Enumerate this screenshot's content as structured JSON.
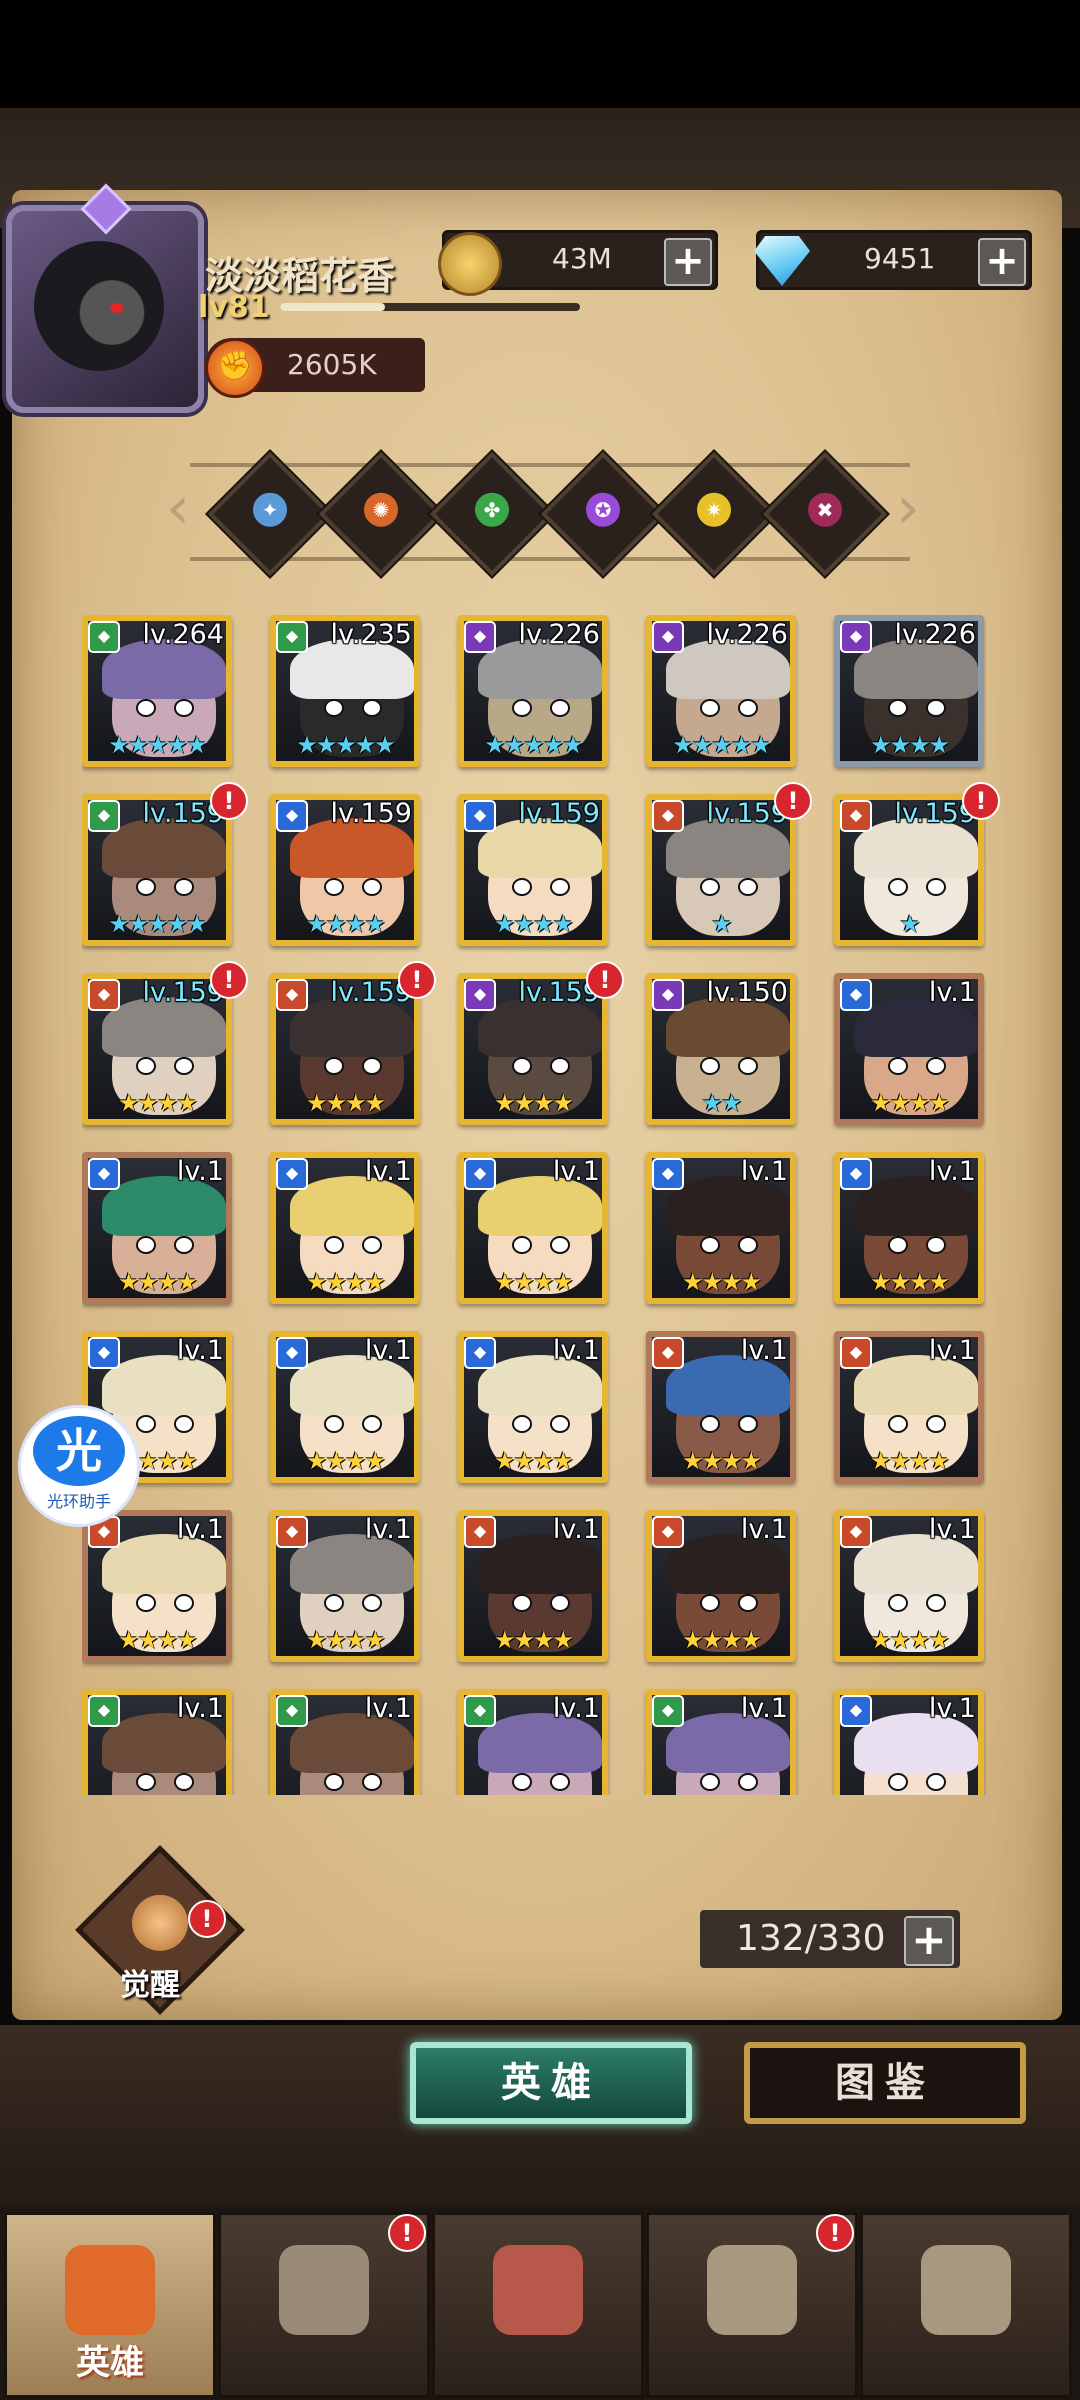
{
  "player": {
    "name": "淡淡稻花香",
    "level": "lv81",
    "xp_fraction": 0.35,
    "power": "2605K"
  },
  "resources": {
    "gold": "43M",
    "diamonds": "9451",
    "plus": "+"
  },
  "filters": [
    {
      "name": "all-element",
      "color": "#5a9ad8",
      "glyph": "✦"
    },
    {
      "name": "fire-element",
      "color": "#d8682a",
      "glyph": "✺"
    },
    {
      "name": "nature-element",
      "color": "#3aa84a",
      "glyph": "✤"
    },
    {
      "name": "arcane-element",
      "color": "#9a4ad8",
      "glyph": "✪"
    },
    {
      "name": "light-element",
      "color": "#e8c128",
      "glyph": "✷"
    },
    {
      "name": "dark-element",
      "color": "#a02a5a",
      "glyph": "✖"
    }
  ],
  "heroes": [
    {
      "lv": "lv.264",
      "stars": "★★★★★",
      "starColor": "#5ad0f0",
      "frame": "#e6b531",
      "elem": "#2e9a4a",
      "lvColor": "#ffffff",
      "alert": false,
      "hair": "#7a6aa8",
      "skin": "#c9a9b8"
    },
    {
      "lv": "lv.235",
      "stars": "★★★★★",
      "starColor": "#5ad0f0",
      "frame": "#e6b531",
      "elem": "#2e9a4a",
      "lvColor": "#ffffff",
      "alert": false,
      "hair": "#e8e8e8",
      "skin": "#2a2a2a"
    },
    {
      "lv": "lv.226",
      "stars": "★★★★★",
      "starColor": "#5ad0f0",
      "frame": "#e6b531",
      "elem": "#7a3ab8",
      "lvColor": "#ffffff",
      "alert": false,
      "hair": "#9a9a9a",
      "skin": "#b8a888"
    },
    {
      "lv": "lv.226",
      "stars": "★★★★★",
      "starColor": "#5ad0f0",
      "frame": "#e6b531",
      "elem": "#7a3ab8",
      "lvColor": "#ffffff",
      "alert": false,
      "hair": "#cfc8c0",
      "skin": "#c4a890"
    },
    {
      "lv": "lv.226",
      "stars": "★★★★",
      "starColor": "#5ad0f0",
      "frame": "#8c9aa8",
      "elem": "#7a3ab8",
      "lvColor": "#ffffff",
      "alert": false,
      "hair": "#8a8580",
      "skin": "#3a302c"
    },
    {
      "lv": "lv.159",
      "stars": "★★★★★",
      "starColor": "#5ad0f0",
      "frame": "#e6b531",
      "elem": "#2e9a4a",
      "lvColor": "#7fe8ff",
      "alert": true,
      "hair": "#6a4a38",
      "skin": "#a98a7c"
    },
    {
      "lv": "lv.159",
      "stars": "★★★★",
      "starColor": "#5ad0f0",
      "frame": "#e6b531",
      "elem": "#2a6ad8",
      "lvColor": "#ffffff",
      "alert": false,
      "hair": "#c8582a",
      "skin": "#f0c8a8"
    },
    {
      "lv": "lv.159",
      "stars": "★★★★",
      "starColor": "#5ad0f0",
      "frame": "#e6b531",
      "elem": "#2a6ad8",
      "lvColor": "#7fe8ff",
      "alert": false,
      "hair": "#e8d8a8",
      "skin": "#f5dcc0"
    },
    {
      "lv": "lv.159",
      "stars": "★",
      "starColor": "#5ad0f0",
      "frame": "#e6b531",
      "elem": "#c84a2a",
      "lvColor": "#7fe8ff",
      "alert": true,
      "hair": "#8a8580",
      "skin": "#d8c8b8"
    },
    {
      "lv": "lv.159",
      "stars": "★",
      "starColor": "#5ad0f0",
      "frame": "#e6b531",
      "elem": "#c84a2a",
      "lvColor": "#7fe8ff",
      "alert": true,
      "hair": "#e8e0d0",
      "skin": "#f0e8dc"
    },
    {
      "lv": "lv.159",
      "stars": "★★★★",
      "starColor": "#ffd23a",
      "frame": "#e6b531",
      "elem": "#c84a2a",
      "lvColor": "#7fe8ff",
      "alert": true,
      "hair": "#8a8580",
      "skin": "#e0d0c0"
    },
    {
      "lv": "lv.159",
      "stars": "★★★★",
      "starColor": "#ffd23a",
      "frame": "#e6b531",
      "elem": "#c84a2a",
      "lvColor": "#7fe8ff",
      "alert": true,
      "hair": "#3a3030",
      "skin": "#5a3a30"
    },
    {
      "lv": "lv.159",
      "stars": "★★★★",
      "starColor": "#ffd23a",
      "frame": "#e6b531",
      "elem": "#7a3ab8",
      "lvColor": "#7fe8ff",
      "alert": true,
      "hair": "#3a3030",
      "skin": "#5a4a40"
    },
    {
      "lv": "lv.150",
      "stars": "★★",
      "starColor": "#5ad0f0",
      "frame": "#e6b531",
      "elem": "#7a3ab8",
      "lvColor": "#ffffff",
      "alert": false,
      "hair": "#6a4a30",
      "skin": "#c8b090"
    },
    {
      "lv": "lv.1",
      "stars": "★★★★",
      "starColor": "#ffd23a",
      "frame": "#b07a5a",
      "elem": "#2a6ad8",
      "lvColor": "#ffffff",
      "alert": false,
      "hair": "#2a2a3a",
      "skin": "#d8a888"
    },
    {
      "lv": "lv.1",
      "stars": "★★★★",
      "starColor": "#ffd23a",
      "frame": "#b07a5a",
      "elem": "#2a6ad8",
      "lvColor": "#ffffff",
      "alert": false,
      "hair": "#2a8a6a",
      "skin": "#d8b098"
    },
    {
      "lv": "lv.1",
      "stars": "★★★★",
      "starColor": "#ffd23a",
      "frame": "#e6b531",
      "elem": "#2a6ad8",
      "lvColor": "#ffffff",
      "alert": false,
      "hair": "#e8d070",
      "skin": "#f5dcc0"
    },
    {
      "lv": "lv.1",
      "stars": "★★★★",
      "starColor": "#ffd23a",
      "frame": "#e6b531",
      "elem": "#2a6ad8",
      "lvColor": "#ffffff",
      "alert": false,
      "hair": "#e8d070",
      "skin": "#f5dcc0"
    },
    {
      "lv": "lv.1",
      "stars": "★★★★",
      "starColor": "#ffd23a",
      "frame": "#e6b531",
      "elem": "#2a6ad8",
      "lvColor": "#ffffff",
      "alert": false,
      "hair": "#2a2020",
      "skin": "#7a4a38"
    },
    {
      "lv": "lv.1",
      "stars": "★★★★",
      "starColor": "#ffd23a",
      "frame": "#e6b531",
      "elem": "#2a6ad8",
      "lvColor": "#ffffff",
      "alert": false,
      "hair": "#2a2020",
      "skin": "#7a4a38"
    },
    {
      "lv": "lv.1",
      "stars": "★★★★",
      "starColor": "#ffd23a",
      "frame": "#e6b531",
      "elem": "#2a6ad8",
      "lvColor": "#ffffff",
      "alert": false,
      "hair": "#e8e0c0",
      "skin": "#f5e0c8"
    },
    {
      "lv": "lv.1",
      "stars": "★★★★",
      "starColor": "#ffd23a",
      "frame": "#e6b531",
      "elem": "#2a6ad8",
      "lvColor": "#ffffff",
      "alert": false,
      "hair": "#e8e0c0",
      "skin": "#f5e0c8"
    },
    {
      "lv": "lv.1",
      "stars": "★★★★",
      "starColor": "#ffd23a",
      "frame": "#e6b531",
      "elem": "#2a6ad8",
      "lvColor": "#ffffff",
      "alert": false,
      "hair": "#e8e0c0",
      "skin": "#f5e0c8"
    },
    {
      "lv": "lv.1",
      "stars": "★★★★",
      "starColor": "#ffd23a",
      "frame": "#b07a5a",
      "elem": "#c84a2a",
      "lvColor": "#ffffff",
      "alert": false,
      "hair": "#3a6ab0",
      "skin": "#8a5a48"
    },
    {
      "lv": "lv.1",
      "stars": "★★★★",
      "starColor": "#ffd23a",
      "frame": "#b07a5a",
      "elem": "#c84a2a",
      "lvColor": "#ffffff",
      "alert": false,
      "hair": "#e8d8b0",
      "skin": "#f5e0c8"
    },
    {
      "lv": "lv.1",
      "stars": "★★★★",
      "starColor": "#ffd23a",
      "frame": "#b07a5a",
      "elem": "#c84a2a",
      "lvColor": "#ffffff",
      "alert": false,
      "hair": "#e8d8b0",
      "skin": "#f5e0c8"
    },
    {
      "lv": "lv.1",
      "stars": "★★★★",
      "starColor": "#ffd23a",
      "frame": "#e6b531",
      "elem": "#c84a2a",
      "lvColor": "#ffffff",
      "alert": false,
      "hair": "#8a8580",
      "skin": "#e0d0c0"
    },
    {
      "lv": "lv.1",
      "stars": "★★★★",
      "starColor": "#ffd23a",
      "frame": "#e6b531",
      "elem": "#c84a2a",
      "lvColor": "#ffffff",
      "alert": false,
      "hair": "#2a2020",
      "skin": "#5a3a30"
    },
    {
      "lv": "lv.1",
      "stars": "★★★★",
      "starColor": "#ffd23a",
      "frame": "#e6b531",
      "elem": "#c84a2a",
      "lvColor": "#ffffff",
      "alert": false,
      "hair": "#2a2020",
      "skin": "#7a4a38"
    },
    {
      "lv": "lv.1",
      "stars": "★★★★",
      "starColor": "#ffd23a",
      "frame": "#e6b531",
      "elem": "#c84a2a",
      "lvColor": "#ffffff",
      "alert": false,
      "hair": "#e8e0d0",
      "skin": "#f0e8dc"
    },
    {
      "lv": "lv.1",
      "stars": "",
      "starColor": "#ffd23a",
      "frame": "#e6b531",
      "elem": "#2e9a4a",
      "lvColor": "#ffffff",
      "alert": false,
      "hair": "#6a4a38",
      "skin": "#a98a7c"
    },
    {
      "lv": "lv.1",
      "stars": "",
      "starColor": "#ffd23a",
      "frame": "#e6b531",
      "elem": "#2e9a4a",
      "lvColor": "#ffffff",
      "alert": false,
      "hair": "#6a4a38",
      "skin": "#a98a7c"
    },
    {
      "lv": "lv.1",
      "stars": "",
      "starColor": "#ffd23a",
      "frame": "#e6b531",
      "elem": "#2e9a4a",
      "lvColor": "#ffffff",
      "alert": false,
      "hair": "#7a6aa8",
      "skin": "#c9a9b8"
    },
    {
      "lv": "lv.1",
      "stars": "",
      "starColor": "#ffd23a",
      "frame": "#e6b531",
      "elem": "#2e9a4a",
      "lvColor": "#ffffff",
      "alert": false,
      "hair": "#7a6aa8",
      "skin": "#c9a9b8"
    },
    {
      "lv": "lv.1",
      "stars": "",
      "starColor": "#ffd23a",
      "frame": "#e6b531",
      "elem": "#2a6ad8",
      "lvColor": "#ffffff",
      "alert": false,
      "hair": "#e8e0f0",
      "skin": "#f5e0d0"
    }
  ],
  "awaken": {
    "label": "觉醒",
    "alert": "!"
  },
  "inventory": {
    "count": "132/330"
  },
  "tabs": {
    "heroes": "英雄",
    "codex": "图鉴"
  },
  "assistant": {
    "glyph": "光",
    "label": "光环助手"
  },
  "nav": [
    {
      "name": "nav-heroes",
      "label": "英雄",
      "alert": false,
      "color": "#e06a2a"
    },
    {
      "name": "nav-adventure",
      "label": "",
      "alert": true,
      "color": "#9a8a78"
    },
    {
      "name": "nav-battle",
      "label": "",
      "alert": false,
      "color": "#b8584a"
    },
    {
      "name": "nav-castle",
      "label": "",
      "alert": true,
      "color": "#a89880"
    },
    {
      "name": "nav-guild",
      "label": "",
      "alert": false,
      "color": "#a89880"
    }
  ],
  "badge_glyph": "!"
}
